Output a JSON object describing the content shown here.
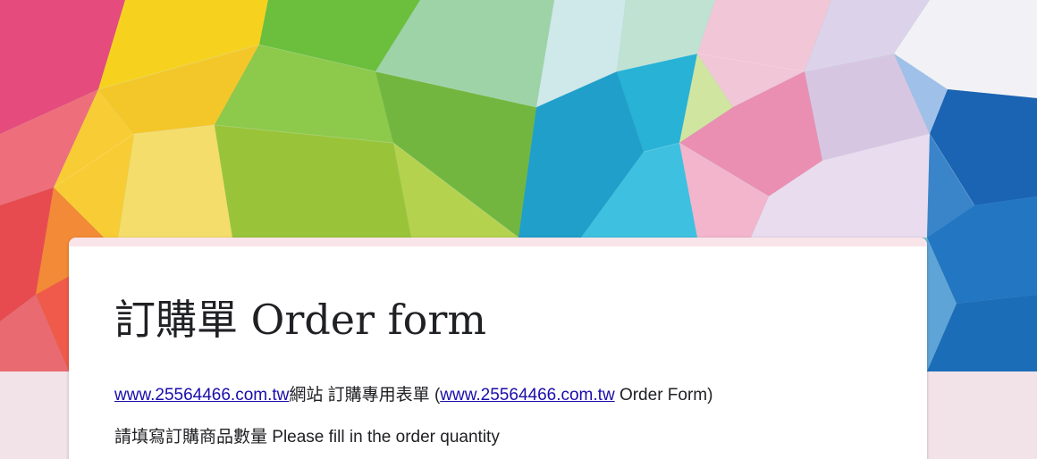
{
  "form": {
    "title": "訂購單 Order form",
    "description": {
      "line1": {
        "link1": "www.25564466.com.tw",
        "text1": "網站 訂購專用表單  (",
        "link2": "www.25564466.com.tw",
        "text2": "  Order Form)"
      },
      "line2": "請填寫訂購商品數量 Please fill in the order quantity"
    }
  },
  "colors": {
    "page_background": "#f2e3e8",
    "card_top_accent": "#f9e4ea",
    "link": "#1a0dab",
    "text": "#202124"
  }
}
